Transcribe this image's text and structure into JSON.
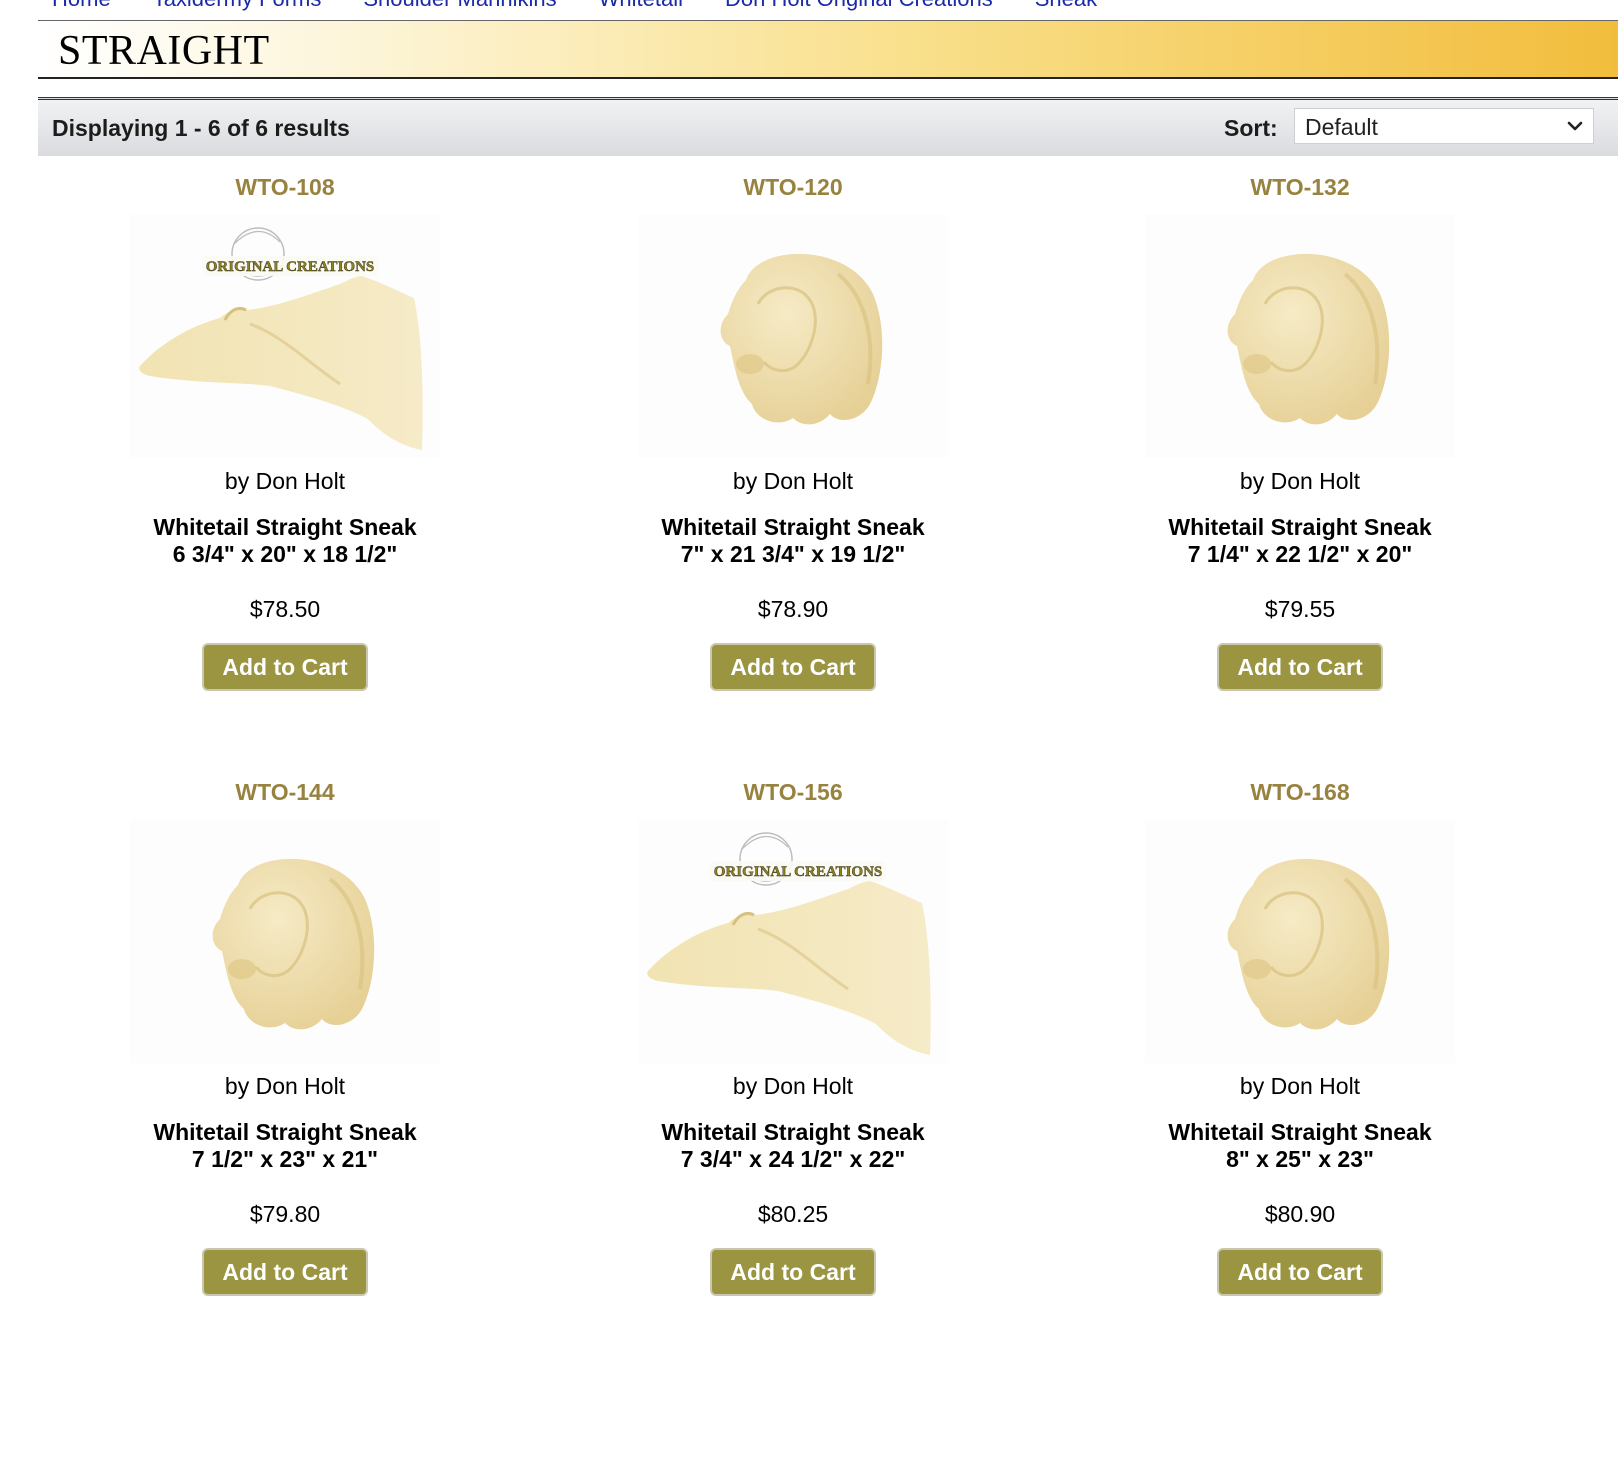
{
  "breadcrumb": [
    "Home",
    "Taxidermy Forms",
    "Shoulder Mannikins",
    "Whitetail",
    "Don Holt Original Creations",
    "Sneak"
  ],
  "page_title": "STRAIGHT",
  "results": {
    "count_text": "Displaying 1 - 6 of 6 results",
    "sort_label": "Sort:",
    "sort_value": "Default"
  },
  "products": [
    {
      "sku": "WTO-108",
      "author": "by Don Holt",
      "name": "Whitetail Straight Sneak",
      "dims": "6 3/4\" x 20\" x 18 1/2\"",
      "price": "$78.50",
      "button": "Add to Cart",
      "image": "side-sneak"
    },
    {
      "sku": "WTO-120",
      "author": "by Don Holt",
      "name": "Whitetail Straight Sneak",
      "dims": "7\" x 21 3/4\" x 19 1/2\"",
      "price": "$78.90",
      "button": "Add to Cart",
      "image": "front-head"
    },
    {
      "sku": "WTO-132",
      "author": "by Don Holt",
      "name": "Whitetail Straight Sneak",
      "dims": "7 1/4\" x 22 1/2\" x 20\"",
      "price": "$79.55",
      "button": "Add to Cart",
      "image": "front-head"
    },
    {
      "sku": "WTO-144",
      "author": "by Don Holt",
      "name": "Whitetail Straight Sneak",
      "dims": "7 1/2\" x 23\" x 21\"",
      "price": "$79.80",
      "button": "Add to Cart",
      "image": "front-head"
    },
    {
      "sku": "WTO-156",
      "author": "by Don Holt",
      "name": "Whitetail Straight Sneak",
      "dims": "7 3/4\" x 24 1/2\" x 22\"",
      "price": "$80.25",
      "button": "Add to Cart",
      "image": "side-sneak"
    },
    {
      "sku": "WTO-168",
      "author": "by Don Holt",
      "name": "Whitetail Straight Sneak",
      "dims": "8\" x 25\" x 23\"",
      "price": "$80.90",
      "button": "Add to Cart",
      "image": "front-head"
    }
  ],
  "logo_text": "ORIGINAL CREATIONS",
  "colors": {
    "sku": "#98823f",
    "button": "#9b9440",
    "form": "#f1e2ad",
    "breadcrumb_link": "#1a2aa8"
  }
}
